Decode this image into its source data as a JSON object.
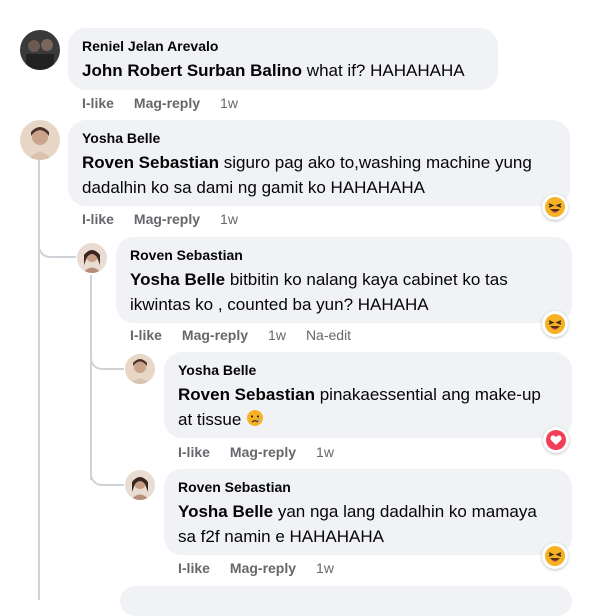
{
  "comments": [
    {
      "author": "Reniel Jelan Arevalo",
      "mention": "John Robert Surban Balino",
      "text": " what if? HAHAHAHA",
      "like": "I-like",
      "reply": "Mag-reply",
      "time": "1w"
    },
    {
      "author": "Yosha Belle",
      "mention": "Roven Sebastian",
      "text": " siguro pag ako to,washing machine yung dadalhin ko sa dami ng gamit ko HAHAHAHA",
      "like": "I-like",
      "reply": "Mag-reply",
      "time": "1w",
      "reaction": "laughing-emoji"
    },
    {
      "author": "Roven Sebastian",
      "mention": "Yosha Belle",
      "text": " bitbitin ko nalang kaya cabinet ko tas ikwintas ko , counted ba yun? HAHAHA",
      "like": "I-like",
      "reply": "Mag-reply",
      "time": "1w",
      "edited": "Na-edit",
      "reaction": "laughing-emoji"
    },
    {
      "author": "Yosha Belle",
      "mention": "Roven Sebastian",
      "text": " pinakaessential ang make-up at tissue",
      "like": "I-like",
      "reply": "Mag-reply",
      "time": "1w",
      "reaction": "heart-emoji",
      "inline_emoji": "crying-face-emoji"
    },
    {
      "author": "Roven Sebastian",
      "mention": "Yosha Belle",
      "text": " yan nga lang dadalhin ko mamaya sa f2f namin e HAHAHAHA",
      "like": "I-like",
      "reply": "Mag-reply",
      "time": "1w",
      "reaction": "laughing-emoji"
    }
  ],
  "colors": {
    "bubble": "#f0f2f5",
    "meta_text": "#65676b",
    "thread_line": "#cfd3d8",
    "heart": "#f33e58",
    "emoji_yellow": "#f7b125"
  }
}
